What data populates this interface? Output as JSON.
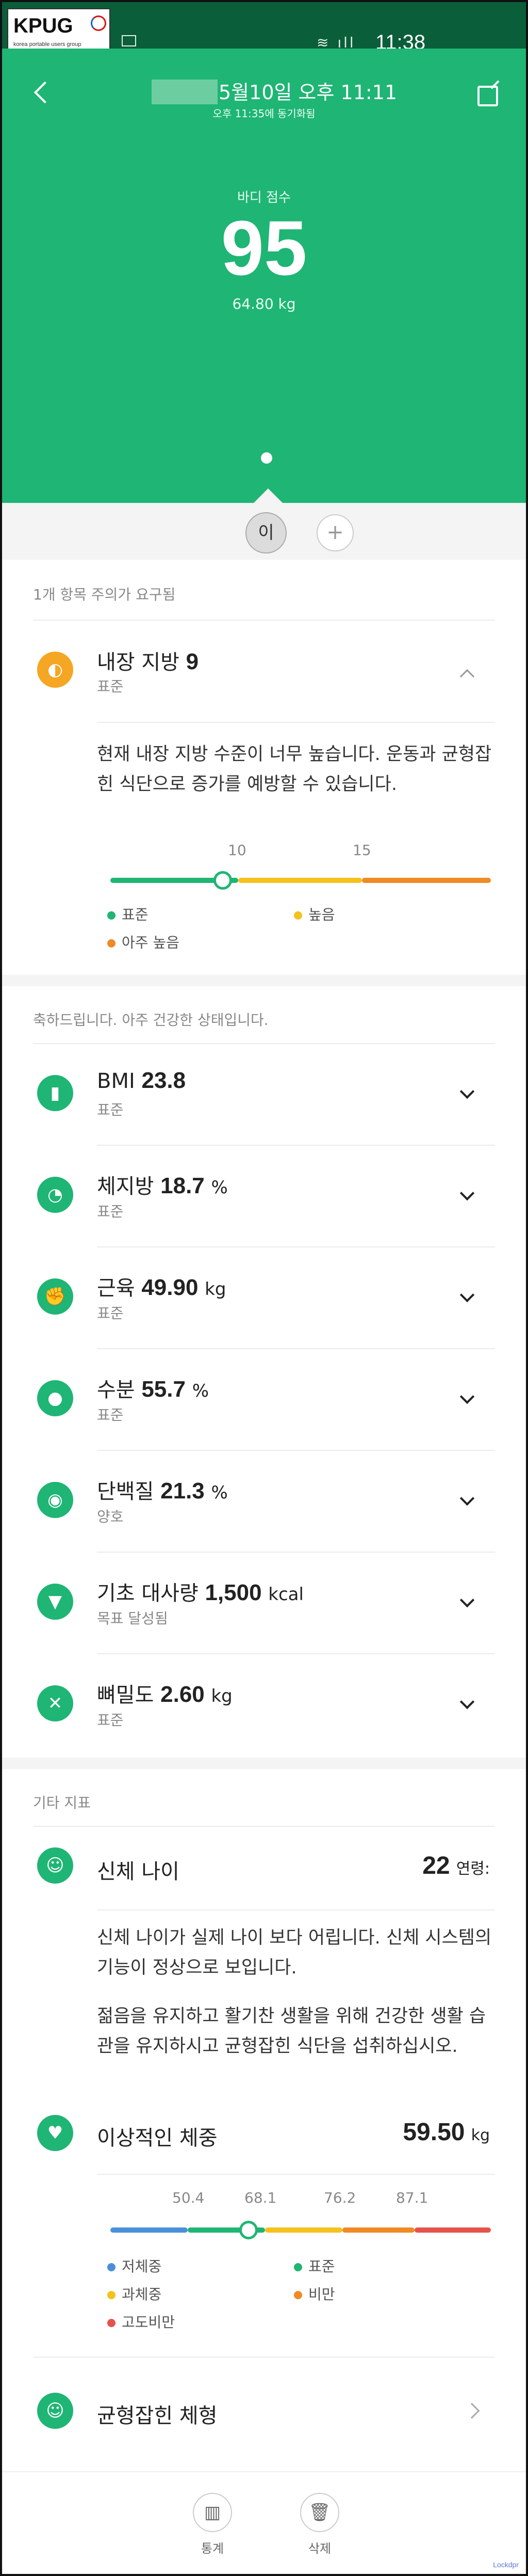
{
  "status_bar": {
    "logo": "KPUG",
    "logo_sub": "korea portable users group",
    "time": "11:38",
    "icons": "≋ ıll"
  },
  "header": {
    "date_title": "5월10일 오후 11:11",
    "sync_time": "오후 11:35에 동기화됨",
    "score_label": "바디 점수",
    "score": "95",
    "weight": "64.80 kg"
  },
  "user_tabs": {
    "current_user": "이",
    "add": "+"
  },
  "attention": {
    "heading": "1개 항목 주의가 요구됨",
    "item": {
      "name": "내장 지방",
      "value": "9",
      "status": "표준",
      "description": "현재 내장 지방 수준이 너무 높습니다. 운동과 균형잡힌 식단으로 증가를 예방할 수 있습니다.",
      "ticks": [
        "10",
        "15"
      ],
      "level": 9,
      "legend": [
        "표준",
        "높음",
        "아주 높음"
      ]
    }
  },
  "healthy": {
    "heading": "축하드립니다. 아주 건강한 상태입니다.",
    "items": [
      {
        "name": "BMI",
        "value": "23.8",
        "unit": "",
        "status": "표준",
        "icon": "bmi-icon"
      },
      {
        "name": "체지방",
        "value": "18.7",
        "unit": "%",
        "status": "표준",
        "icon": "body-fat-icon"
      },
      {
        "name": "근육",
        "value": "49.90",
        "unit": "kg",
        "status": "표준",
        "icon": "muscle-icon"
      },
      {
        "name": "수분",
        "value": "55.7",
        "unit": "%",
        "status": "표준",
        "icon": "water-drop-icon"
      },
      {
        "name": "단백질",
        "value": "21.3",
        "unit": "%",
        "status": "양호",
        "icon": "protein-icon"
      },
      {
        "name": "기초 대사량",
        "value": "1,500",
        "unit": "kcal",
        "status": "목표 달성됨",
        "icon": "metabolism-icon"
      },
      {
        "name": "뼈밀도",
        "value": "2.60",
        "unit": "kg",
        "status": "표준",
        "icon": "bone-icon"
      }
    ]
  },
  "other": {
    "heading": "기타 지표",
    "body_age": {
      "name": "신체 나이",
      "value": "22",
      "unit": "연령:",
      "desc1": "신체 나이가 실제 나이 보다 어립니다. 신체 시스템의 기능이 정상으로 보입니다.",
      "desc2": "젊음을 유지하고 활기찬 생활을 위해 건강한 생활 습관을 유지하시고 균형잡힌 식단을 섭취하십시오."
    },
    "ideal_weight": {
      "name": "이상적인 체중",
      "value": "59.50",
      "unit": "kg",
      "ticks": [
        "50.4",
        "68.1",
        "76.2",
        "87.1"
      ],
      "level": 64.8,
      "legend": [
        "저체중",
        "표준",
        "과체중",
        "비만",
        "고도비만"
      ]
    },
    "body_type": {
      "name": "균형잡힌 체형"
    }
  },
  "bottom_nav": {
    "stats": "통계",
    "delete": "삭제"
  },
  "colors": {
    "primary": "#1fb574",
    "yellow": "#f5c11c",
    "orange": "#f08a24",
    "red": "#e5534b",
    "blue": "#4a90d9"
  }
}
